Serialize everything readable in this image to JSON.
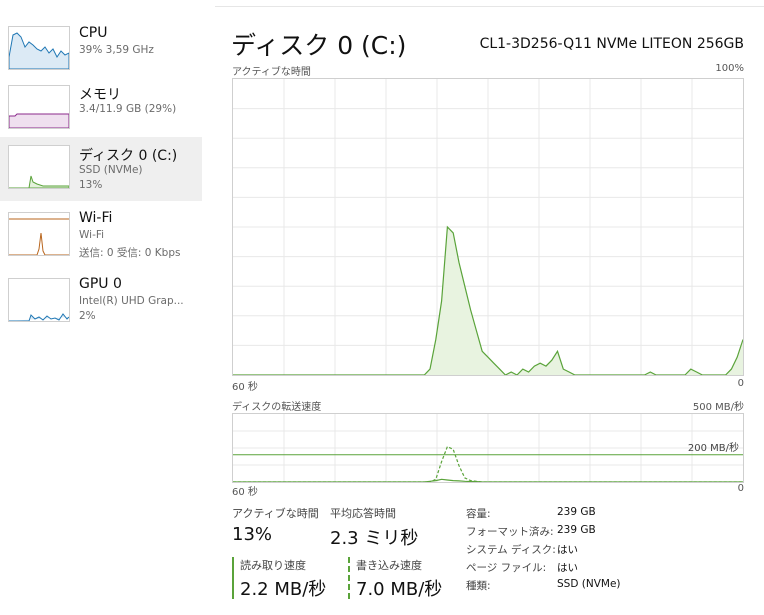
{
  "sidebar": {
    "items": [
      {
        "title": "CPU",
        "sub1": "39%  3,59 GHz",
        "sub2": ""
      },
      {
        "title": "メモリ",
        "sub1": "3.4/11.9 GB (29%)",
        "sub2": ""
      },
      {
        "title": "ディスク 0 (C:)",
        "sub1": "SSD (NVMe)",
        "sub2": "13%"
      },
      {
        "title": "Wi-Fi",
        "sub1": "Wi-Fi",
        "sub2": "送信: 0 受信: 0 Kbps"
      },
      {
        "title": "GPU 0",
        "sub1": "Intel(R) UHD Grap...",
        "sub2": "2%"
      }
    ],
    "colors": {
      "cpu": "#1f77b4",
      "memory": "#8b2a8b",
      "disk": "#5aa33a",
      "wifi": "#b8651d",
      "gpu": "#1f77b4"
    }
  },
  "main": {
    "title": "ディスク 0 (C:)",
    "device": "CL1-3D256-Q11 NVMe LITEON 256GB",
    "chart1": {
      "label": "アクティブな時間",
      "max": "100%",
      "left": "60 秒",
      "right": "0"
    },
    "chart2": {
      "label": "ディスクの転送速度",
      "max": "500 MB/秒",
      "left": "60 秒",
      "right": "0",
      "ref_line_label": "200 MB/秒"
    }
  },
  "stats": {
    "active_label": "アクティブな時間",
    "active_value": "13%",
    "response_label": "平均応答時間",
    "response_value": "2.3 ミリ秒",
    "read_label": "読み取り速度",
    "read_value": "2.2 MB/秒",
    "write_label": "書き込み速度",
    "write_value": "7.0 MB/秒"
  },
  "info": [
    {
      "label": "容量:",
      "value": "239 GB"
    },
    {
      "label": "フォーマット済み:",
      "value": "239 GB"
    },
    {
      "label": "システム ディスク:",
      "value": "はい"
    },
    {
      "label": "ページ ファイル:",
      "value": "はい"
    },
    {
      "label": "種類:",
      "value": "SSD (NVMe)"
    }
  ],
  "chart_data": {
    "type": "area",
    "ylim": [
      0,
      100
    ],
    "active_time": [
      0,
      0,
      0,
      0,
      0,
      0,
      0,
      0,
      0,
      0,
      0,
      0,
      0,
      0,
      0,
      0,
      0,
      0,
      0,
      0,
      0,
      0,
      0,
      0,
      0,
      0,
      0,
      0,
      0,
      0,
      0,
      0,
      0,
      0,
      2,
      12,
      25,
      50,
      48,
      38,
      30,
      22,
      15,
      8,
      6,
      4,
      2,
      0,
      1,
      0,
      2,
      1,
      3,
      4,
      3,
      5,
      8,
      2,
      1,
      0,
      0,
      0,
      0,
      0,
      0,
      0,
      0,
      0,
      0,
      0,
      0,
      0,
      1,
      0,
      0,
      0,
      0,
      0,
      0,
      2,
      1,
      0,
      0,
      0,
      0,
      0,
      2,
      6,
      12
    ],
    "transfer": {
      "ylim": [
        0,
        500
      ],
      "ref_line": 200,
      "write": [
        0,
        0,
        0,
        0,
        0,
        0,
        0,
        0,
        0,
        0,
        0,
        0,
        0,
        0,
        0,
        0,
        0,
        0,
        0,
        0,
        0,
        0,
        0,
        0,
        0,
        0,
        0,
        0,
        0,
        0,
        0,
        0,
        0,
        0,
        0,
        20,
        150,
        260,
        240,
        120,
        30,
        10,
        5,
        0,
        0,
        0,
        0,
        0,
        0,
        0,
        0,
        0,
        0,
        0,
        0,
        0,
        0,
        0,
        0,
        0,
        0,
        0,
        0,
        0,
        0,
        0,
        0,
        0,
        0,
        0,
        0,
        0,
        0,
        0,
        0,
        0,
        0,
        0,
        0,
        0,
        0,
        0,
        0,
        0,
        0,
        0,
        0,
        0,
        0
      ],
      "read": [
        0,
        0,
        0,
        0,
        0,
        0,
        0,
        0,
        0,
        0,
        0,
        0,
        0,
        0,
        0,
        0,
        0,
        0,
        0,
        0,
        0,
        0,
        0,
        0,
        0,
        0,
        0,
        0,
        0,
        0,
        0,
        0,
        0,
        0,
        5,
        10,
        20,
        15,
        10,
        8,
        5,
        4,
        3,
        0,
        0,
        0,
        0,
        0,
        0,
        0,
        0,
        0,
        0,
        0,
        0,
        0,
        0,
        0,
        0,
        0,
        0,
        0,
        0,
        0,
        0,
        0,
        0,
        0,
        0,
        0,
        0,
        0,
        0,
        0,
        0,
        0,
        0,
        0,
        0,
        0,
        0,
        0,
        0,
        0,
        0,
        0,
        0,
        0,
        0
      ]
    }
  }
}
